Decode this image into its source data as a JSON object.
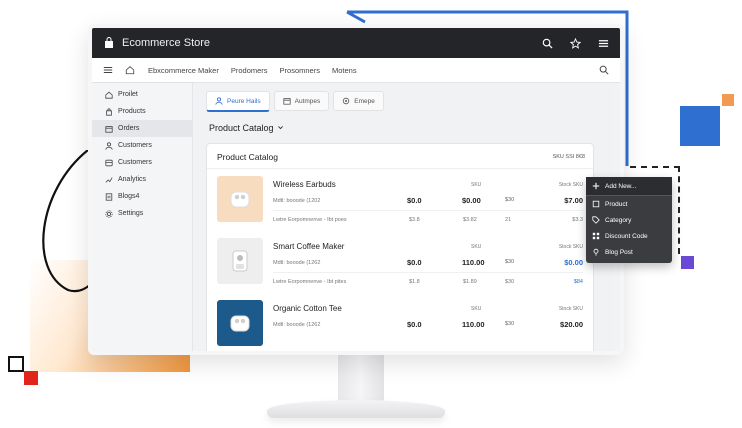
{
  "app": {
    "title": "Ecommerce Store"
  },
  "navbar": {
    "links": [
      "Ebxcommerce Maker",
      "Prodomers",
      "Prosomners",
      "Motens"
    ]
  },
  "sidebar": {
    "items": [
      {
        "label": "Proilet",
        "icon": "home-icon"
      },
      {
        "label": "Products",
        "icon": "bag-icon"
      },
      {
        "label": "Orders",
        "icon": "box-icon",
        "active": true
      },
      {
        "label": "Customers",
        "icon": "users-icon"
      },
      {
        "label": "Customers",
        "icon": "card-icon"
      },
      {
        "label": "Analytics",
        "icon": "chart-icon"
      },
      {
        "label": "Blogs4",
        "icon": "blog-icon"
      },
      {
        "label": "Settings",
        "icon": "gear-icon"
      }
    ]
  },
  "tabs": [
    {
      "label": "Peure Hails",
      "icon": "user-icon",
      "active": true
    },
    {
      "label": "Autmpes",
      "icon": "calendar-icon"
    },
    {
      "label": "Emepe",
      "icon": "circle-icon"
    }
  ],
  "catalog": {
    "heading": "Product Catalog",
    "card_title": "Product Catalog",
    "card_sku": "SKU SSI 8€8",
    "products": [
      {
        "name": "Wireless Earbuds",
        "model": "Mdtl: booode (1202",
        "desc": "Lwtre Eorpomnenve - Ibt poes",
        "sku_label": "SKU",
        "stock_label": "Stock SKU",
        "v1": "$0.0",
        "v2": "$0.00",
        "v3": "$30",
        "v4": "$7.00",
        "s1": "$3.8",
        "s2": "$3.82",
        "s3": "21",
        "s4": "$3.3",
        "thumb_bg": "#f7dcbf",
        "v4_color": "#222222"
      },
      {
        "name": "Smart Coffee Maker",
        "model": "Mdtl: booode (1262",
        "desc": "Lwtre Eorpomnenve - Ibt pites",
        "sku_label": "SKU",
        "stock_label": "Stock SKU",
        "v1": "$0.0",
        "v2": "110.00",
        "v3": "$30",
        "v4": "$0.00",
        "s1": "$1.8",
        "s2": "$1.89",
        "s3": "$30",
        "s4": "$84",
        "thumb_bg": "#eeeeee",
        "v4_color": "#2f6fd1"
      },
      {
        "name": "Organic Cotton Tee",
        "model": "Mdtl: booode (1262",
        "desc": "",
        "sku_label": "SKU",
        "stock_label": "Stock SKU",
        "v1": "$0.0",
        "v2": "110.00",
        "v3": "$30",
        "v4": "$20.00",
        "thumb_bg": "#1d5a8c",
        "v4_color": "#222222"
      }
    ]
  },
  "dropdown": {
    "header": "Add New...",
    "items": [
      {
        "label": "Product",
        "icon": "product-icon"
      },
      {
        "label": "Category",
        "icon": "tag-icon"
      },
      {
        "label": "Discount Code",
        "icon": "grid-icon"
      },
      {
        "label": "Blog Post",
        "icon": "pin-icon"
      }
    ]
  }
}
